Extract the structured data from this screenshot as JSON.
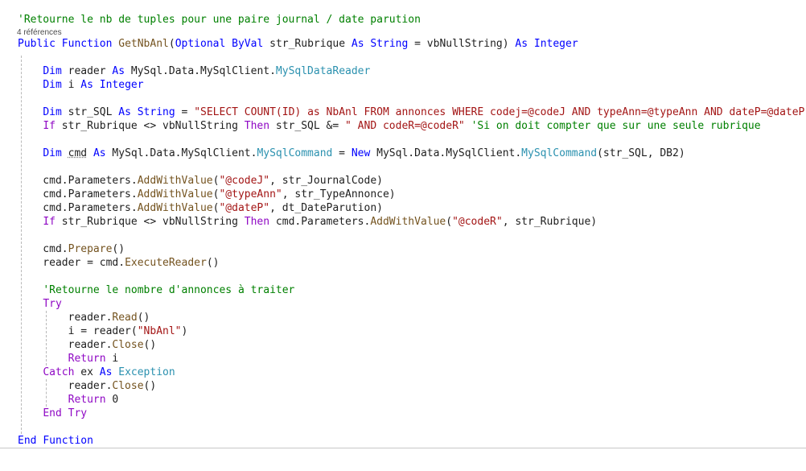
{
  "editor": {
    "codelens": "4 références",
    "colors": {
      "keyword": "#0000ff",
      "control": "#8f08c4",
      "string": "#a31515",
      "comment": "#008000",
      "type": "#2b91af",
      "method": "#74531f",
      "text": "#1e1e1e"
    },
    "lines": [
      [
        [
          "com",
          "'Retourne le nb de tuples pour une paire journal / date parution"
        ]
      ],
      [
        [
          "kw",
          "Public"
        ],
        [
          "op",
          " "
        ],
        [
          "kw",
          "Function"
        ],
        [
          "op",
          " "
        ],
        [
          "fn",
          "GetNbAnl"
        ],
        [
          "op",
          "("
        ],
        [
          "kw",
          "Optional"
        ],
        [
          "op",
          " "
        ],
        [
          "kw",
          "ByVal"
        ],
        [
          "op",
          " str_Rubrique "
        ],
        [
          "kw",
          "As"
        ],
        [
          "op",
          " "
        ],
        [
          "kw",
          "String"
        ],
        [
          "op",
          " = vbNullString) "
        ],
        [
          "kw",
          "As"
        ],
        [
          "op",
          " "
        ],
        [
          "kw",
          "Integer"
        ]
      ],
      [],
      [
        [
          "op",
          "    "
        ],
        [
          "kw",
          "Dim"
        ],
        [
          "op",
          " reader "
        ],
        [
          "kw",
          "As"
        ],
        [
          "op",
          " MySql.Data.MySqlClient."
        ],
        [
          "type",
          "MySqlDataReader"
        ]
      ],
      [
        [
          "op",
          "    "
        ],
        [
          "kw",
          "Dim"
        ],
        [
          "op",
          " i "
        ],
        [
          "kw",
          "As"
        ],
        [
          "op",
          " "
        ],
        [
          "kw",
          "Integer"
        ]
      ],
      [],
      [
        [
          "op",
          "    "
        ],
        [
          "kw",
          "Dim"
        ],
        [
          "op",
          " str_SQL "
        ],
        [
          "kw",
          "As"
        ],
        [
          "op",
          " "
        ],
        [
          "kw",
          "String"
        ],
        [
          "op",
          " = "
        ],
        [
          "str",
          "\"SELECT COUNT(ID) as NbAnl FROM annonces WHERE codej=@codeJ AND typeAnn=@typeAnn AND dateP=@dateP\""
        ]
      ],
      [
        [
          "op",
          "    "
        ],
        [
          "ctl",
          "If"
        ],
        [
          "op",
          " str_Rubrique <> vbNullString "
        ],
        [
          "ctl",
          "Then"
        ],
        [
          "op",
          " str_SQL &= "
        ],
        [
          "str",
          "\" AND codeR=@codeR\""
        ],
        [
          "op",
          " "
        ],
        [
          "com",
          "'Si on doit compter que sur une seule rubrique"
        ]
      ],
      [],
      [
        [
          "op",
          "    "
        ],
        [
          "kw",
          "Dim"
        ],
        [
          "op",
          " "
        ],
        [
          "hint",
          "cmd"
        ],
        [
          "op",
          " "
        ],
        [
          "kw",
          "As"
        ],
        [
          "op",
          " MySql.Data.MySqlClient."
        ],
        [
          "type",
          "MySqlCommand"
        ],
        [
          "op",
          " = "
        ],
        [
          "kw",
          "New"
        ],
        [
          "op",
          " MySql.Data.MySqlClient."
        ],
        [
          "type",
          "MySqlCommand"
        ],
        [
          "op",
          "(str_SQL, DB2)"
        ]
      ],
      [],
      [
        [
          "op",
          "    cmd.Parameters."
        ],
        [
          "fn",
          "AddWithValue"
        ],
        [
          "op",
          "("
        ],
        [
          "str",
          "\"@codeJ\""
        ],
        [
          "op",
          ", str_JournalCode)"
        ]
      ],
      [
        [
          "op",
          "    cmd.Parameters."
        ],
        [
          "fn",
          "AddWithValue"
        ],
        [
          "op",
          "("
        ],
        [
          "str",
          "\"@typeAnn\""
        ],
        [
          "op",
          ", str_TypeAnnonce)"
        ]
      ],
      [
        [
          "op",
          "    cmd.Parameters."
        ],
        [
          "fn",
          "AddWithValue"
        ],
        [
          "op",
          "("
        ],
        [
          "str",
          "\"@dateP\""
        ],
        [
          "op",
          ", dt_DateParution)"
        ]
      ],
      [
        [
          "op",
          "    "
        ],
        [
          "ctl",
          "If"
        ],
        [
          "op",
          " str_Rubrique <> vbNullString "
        ],
        [
          "ctl",
          "Then"
        ],
        [
          "op",
          " cmd.Parameters."
        ],
        [
          "fn",
          "AddWithValue"
        ],
        [
          "op",
          "("
        ],
        [
          "str",
          "\"@codeR\""
        ],
        [
          "op",
          ", str_Rubrique)"
        ]
      ],
      [],
      [
        [
          "op",
          "    cmd."
        ],
        [
          "fn",
          "Prepare"
        ],
        [
          "op",
          "()"
        ]
      ],
      [
        [
          "op",
          "    reader = cmd."
        ],
        [
          "fn",
          "ExecuteReader"
        ],
        [
          "op",
          "()"
        ]
      ],
      [],
      [
        [
          "op",
          "    "
        ],
        [
          "com",
          "'Retourne le nombre d'annonces à traiter"
        ]
      ],
      [
        [
          "op",
          "    "
        ],
        [
          "ctl",
          "Try"
        ]
      ],
      [
        [
          "op",
          "        reader."
        ],
        [
          "fn",
          "Read"
        ],
        [
          "op",
          "()"
        ]
      ],
      [
        [
          "op",
          "        i = reader("
        ],
        [
          "str",
          "\"NbAnl\""
        ],
        [
          "op",
          ")"
        ]
      ],
      [
        [
          "op",
          "        reader."
        ],
        [
          "fn",
          "Close"
        ],
        [
          "op",
          "()"
        ]
      ],
      [
        [
          "op",
          "        "
        ],
        [
          "ctl",
          "Return"
        ],
        [
          "op",
          " i"
        ]
      ],
      [
        [
          "op",
          "    "
        ],
        [
          "ctl",
          "Catch"
        ],
        [
          "op",
          " ex "
        ],
        [
          "kw",
          "As"
        ],
        [
          "op",
          " "
        ],
        [
          "type",
          "Exception"
        ]
      ],
      [
        [
          "op",
          "        reader."
        ],
        [
          "fn",
          "Close"
        ],
        [
          "op",
          "()"
        ]
      ],
      [
        [
          "op",
          "        "
        ],
        [
          "ctl",
          "Return"
        ],
        [
          "op",
          " 0"
        ]
      ],
      [
        [
          "op",
          "    "
        ],
        [
          "ctl",
          "End"
        ],
        [
          "op",
          " "
        ],
        [
          "ctl",
          "Try"
        ]
      ],
      [],
      [
        [
          "kw",
          "End"
        ],
        [
          "op",
          " "
        ],
        [
          "kw",
          "Function"
        ]
      ]
    ]
  }
}
